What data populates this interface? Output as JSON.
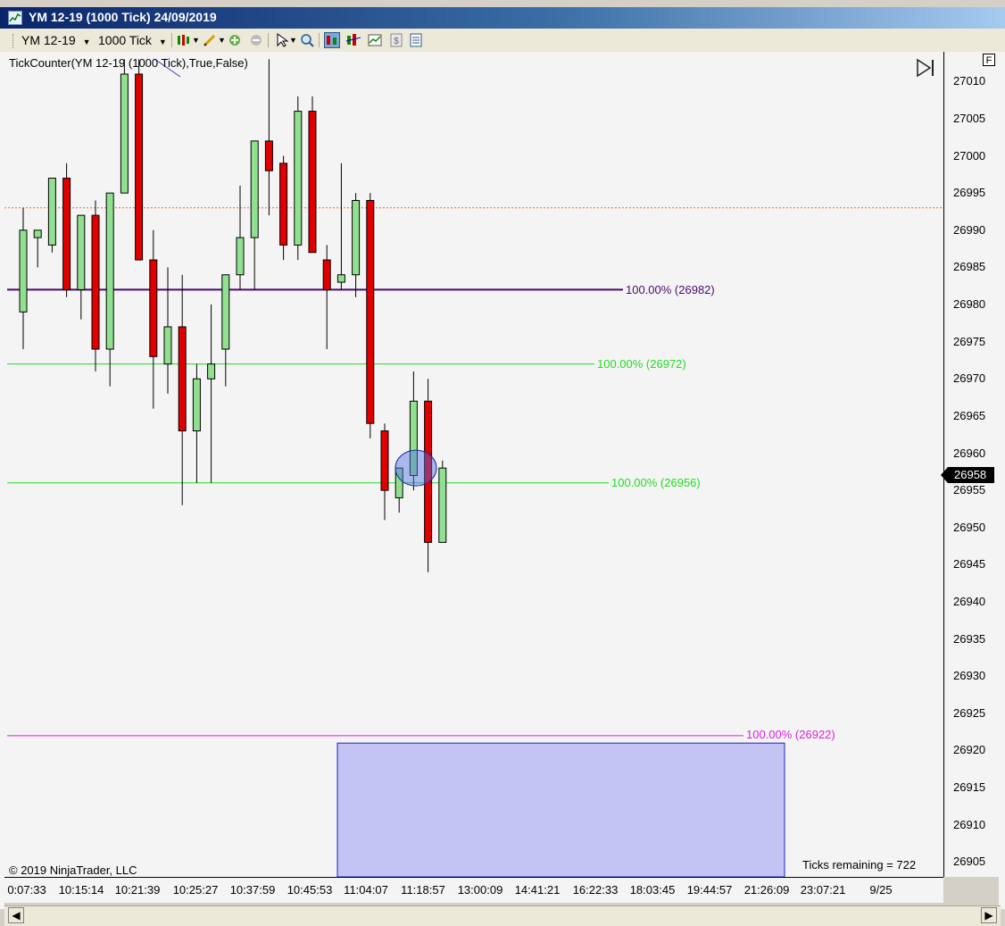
{
  "window": {
    "title": "YM 12-19 (1000 Tick)  24/09/2019"
  },
  "toolbar": {
    "instrument": "YM 12-19",
    "interval": "1000 Tick"
  },
  "chart": {
    "indicator_label": "TickCounter(YM  12-19 (1000  Tick),True,False)",
    "copyright": "© 2019 NinjaTrader, LLC",
    "ticks_remaining": "Ticks remaining = 722",
    "f_tag": "F",
    "current_price": "26958",
    "level_labels": {
      "purple": "100.00% (26982)",
      "green_upper": "100.00% (26972)",
      "green_lower": "100.00% (26956)",
      "magenta": "100.00% (26922)"
    },
    "colors": {
      "up": "#90e090",
      "down": "#e00000",
      "purple_line": "#4b0a6b",
      "green_line": "#22dd22",
      "magenta_line": "#dd22dd",
      "zone_fill": "#c4c4f4"
    }
  },
  "chart_data": {
    "type": "candlestick",
    "instrument": "YM 12-19",
    "interval": "1000 Tick",
    "ylim": [
      26903,
      27014
    ],
    "y_ticks": [
      27010,
      27005,
      27000,
      26995,
      26990,
      26985,
      26980,
      26975,
      26970,
      26965,
      26960,
      26955,
      26950,
      26945,
      26940,
      26935,
      26930,
      26925,
      26920,
      26915,
      26910,
      26905
    ],
    "x_tick_labels": [
      "0:07:33",
      "10:15:14",
      "10:21:39",
      "10:25:27",
      "10:37:59",
      "10:45:53",
      "11:04:07",
      "11:18:57",
      "13:00:09",
      "14:41:21",
      "16:22:33",
      "18:03:45",
      "19:44:57",
      "21:26:09",
      "23:07:21",
      "9/25"
    ],
    "candles": [
      {
        "open": 26979,
        "high": 26993,
        "low": 26974,
        "close": 26990
      },
      {
        "open": 26989,
        "high": 26990,
        "low": 26985,
        "close": 26990
      },
      {
        "open": 26988,
        "high": 26997,
        "low": 26987,
        "close": 26997
      },
      {
        "open": 26997,
        "high": 26999,
        "low": 26981,
        "close": 26982
      },
      {
        "open": 26982,
        "high": 26991,
        "low": 26978,
        "close": 26992
      },
      {
        "open": 26992,
        "high": 26994,
        "low": 26971,
        "close": 26974
      },
      {
        "open": 26974,
        "high": 26991,
        "low": 26969,
        "close": 26995
      },
      {
        "open": 26995,
        "high": 27013,
        "low": 26995,
        "close": 27011
      },
      {
        "open": 27011,
        "high": 27013,
        "low": 26986,
        "close": 26986
      },
      {
        "open": 26986,
        "high": 26990,
        "low": 26966,
        "close": 26973
      },
      {
        "open": 26972,
        "high": 26985,
        "low": 26968,
        "close": 26977
      },
      {
        "open": 26977,
        "high": 26984,
        "low": 26953,
        "close": 26963
      },
      {
        "open": 26963,
        "high": 26972,
        "low": 26956,
        "close": 26970
      },
      {
        "open": 26970,
        "high": 26980,
        "low": 26956,
        "close": 26972
      },
      {
        "open": 26974,
        "high": 26984,
        "low": 26969,
        "close": 26984
      },
      {
        "open": 26984,
        "high": 26996,
        "low": 26982,
        "close": 26989
      },
      {
        "open": 26989,
        "high": 27002,
        "low": 26982,
        "close": 27002
      },
      {
        "open": 27002,
        "high": 27013,
        "low": 26992,
        "close": 26998
      },
      {
        "open": 26999,
        "high": 27000,
        "low": 26986,
        "close": 26988
      },
      {
        "open": 26988,
        "high": 27008,
        "low": 26986,
        "close": 27006
      },
      {
        "open": 27006,
        "high": 27008,
        "low": 26987,
        "close": 26987
      },
      {
        "open": 26986,
        "high": 26988,
        "low": 26974,
        "close": 26982
      },
      {
        "open": 26983,
        "high": 26999,
        "low": 26982,
        "close": 26984
      },
      {
        "open": 26984,
        "high": 26995,
        "low": 26981,
        "close": 26994
      },
      {
        "open": 26994,
        "high": 26995,
        "low": 26962,
        "close": 26964
      },
      {
        "open": 26963,
        "high": 26964,
        "low": 26951,
        "close": 26955
      },
      {
        "open": 26954,
        "high": 26958,
        "low": 26952,
        "close": 26958
      },
      {
        "open": 26957,
        "high": 26971,
        "low": 26955,
        "close": 26967
      },
      {
        "open": 26967,
        "high": 26970,
        "low": 26944,
        "close": 26948
      },
      {
        "open": 26948,
        "high": 26959,
        "low": 26948,
        "close": 26958
      }
    ],
    "levels": [
      {
        "label": "100.00% (26982)",
        "value": 26982,
        "color": "#4b0a6b"
      },
      {
        "label": "100.00% (26972)",
        "value": 26972,
        "color": "#22dd22"
      },
      {
        "label": "100.00% (26956)",
        "value": 26956,
        "color": "#22dd22"
      },
      {
        "label": "100.00% (26922)",
        "value": 26922,
        "color": "#dd22dd"
      }
    ],
    "dashed_line_value": 26993,
    "zone": {
      "top": 26921,
      "bottom": 26903
    },
    "current_price": 26958
  }
}
